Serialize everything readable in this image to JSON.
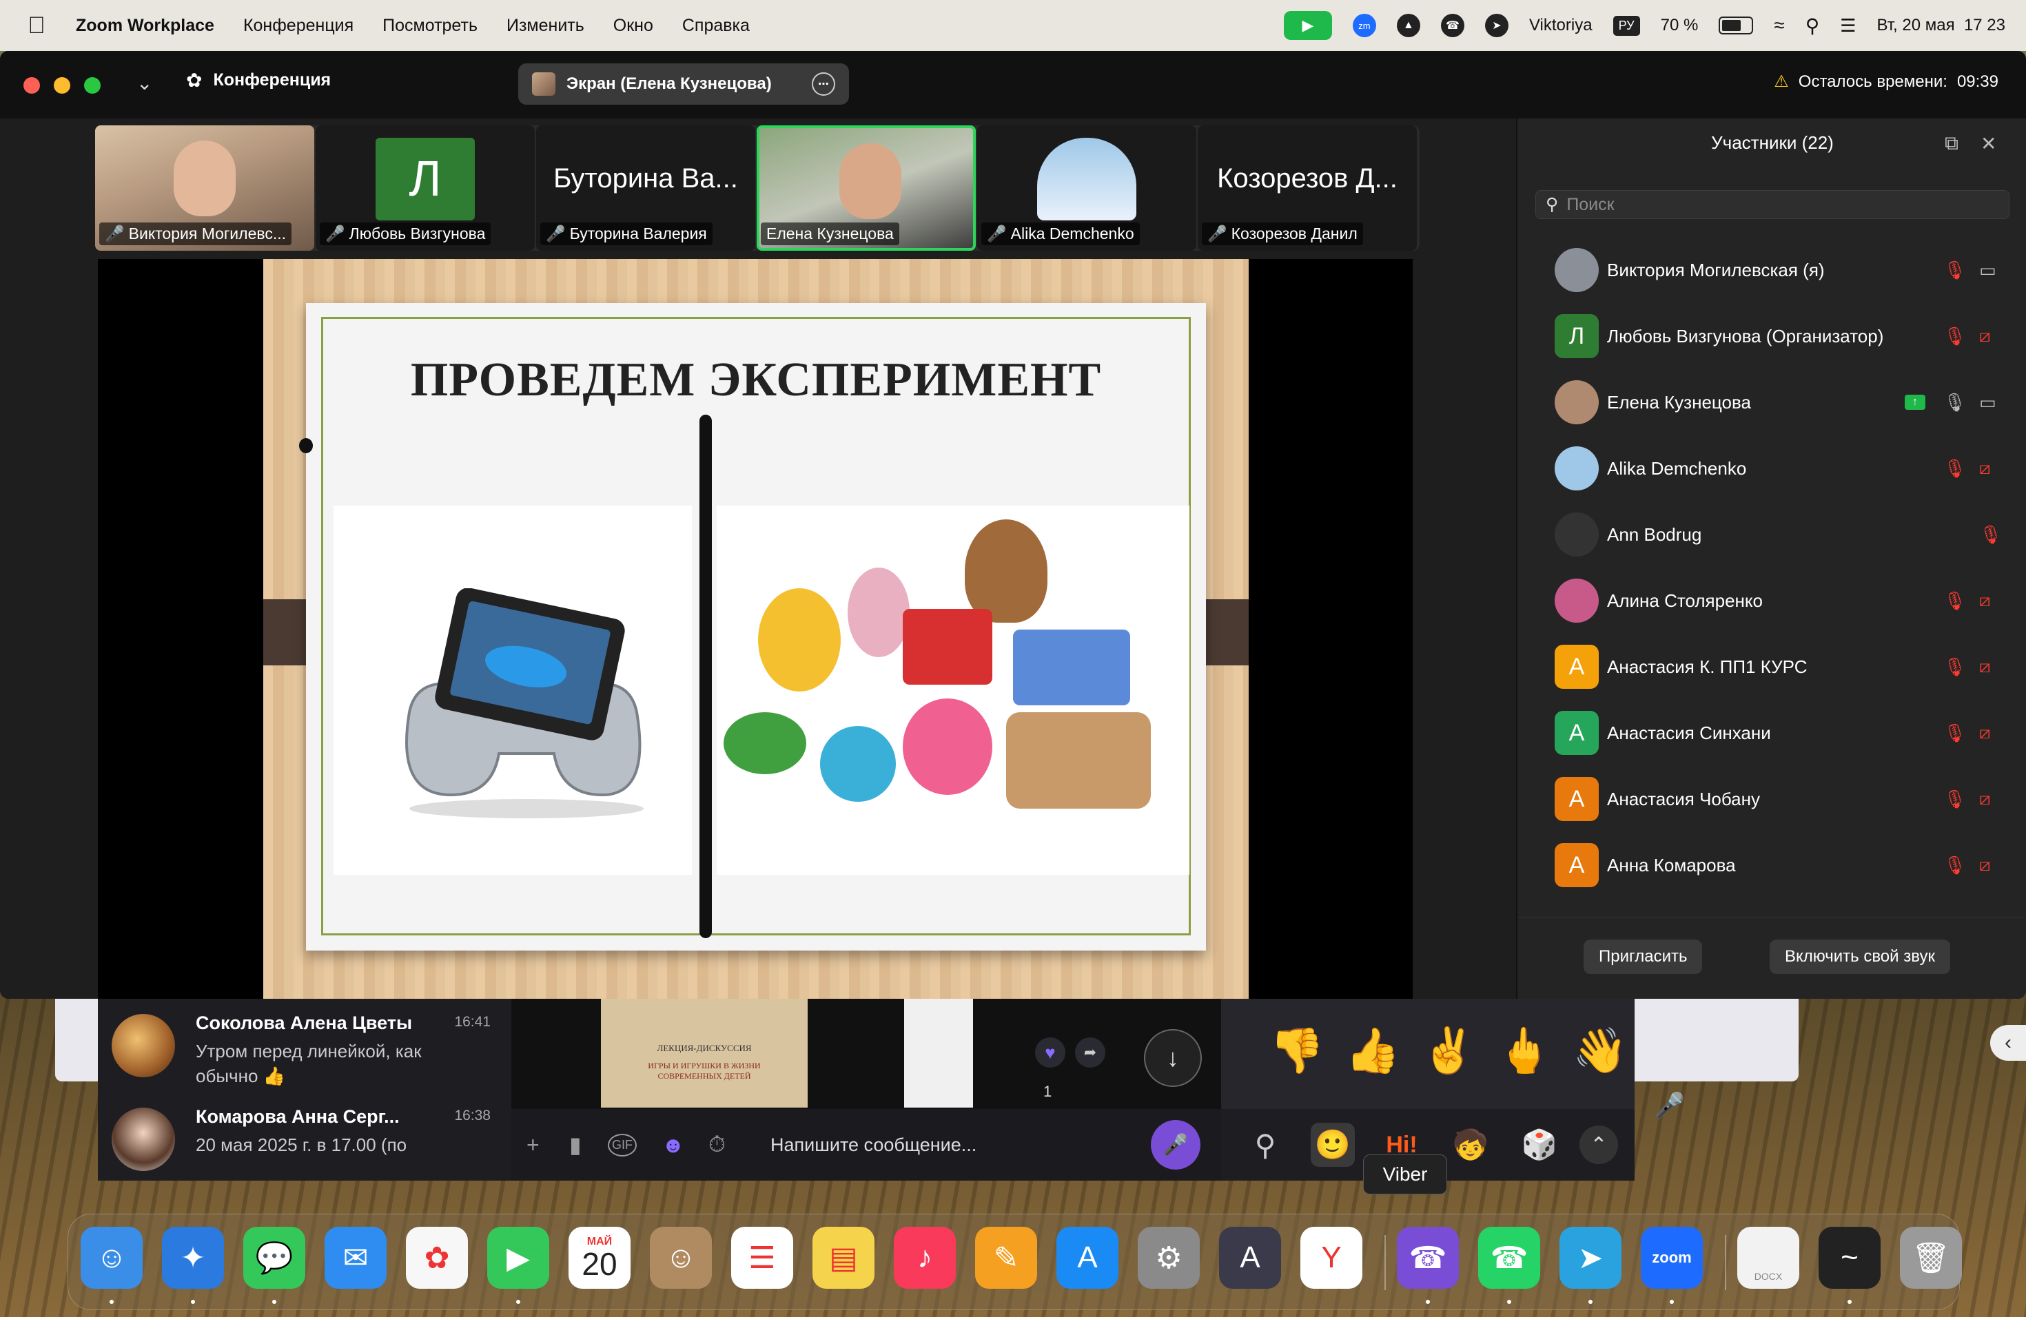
{
  "menubar": {
    "app_name": "Zoom Workplace",
    "menus": [
      "Конференция",
      "Посмотреть",
      "Изменить",
      "Окно",
      "Справка"
    ],
    "user": "Viktoriya",
    "input_source": "РУ",
    "battery": "70 %",
    "battery_level": 0.7,
    "datetime": "Вт, 20 мая  17 23"
  },
  "zoom": {
    "title": "Конференция",
    "screen_share_label": "Экран (Елена Кузнецова)",
    "time_left_label": "Осталось времени:",
    "time_left_value": "09:39",
    "tiles": [
      {
        "name": "Виктория Могилевс...",
        "muted": true
      },
      {
        "name": "Любовь Визгунова",
        "muted": true,
        "letter": "Л"
      },
      {
        "name": "Буторина Валерия",
        "muted": true,
        "big": "Буторина Ва..."
      },
      {
        "name": "Елена Кузнецова",
        "muted": false
      },
      {
        "name": "Alika Demchenko",
        "muted": true
      },
      {
        "name": "Козорезов Данил",
        "muted": true,
        "big": "Козорезов Д..."
      }
    ],
    "slide_title": "ПРОВЕДЕМ ЭКСПЕРИМЕНТ"
  },
  "participants": {
    "header": "Участники (22)",
    "search_placeholder": "Поиск",
    "items": [
      {
        "name": "Виктория Могилевская (я)",
        "avatar": "photo",
        "color": "#8a8f98",
        "mic": "off",
        "cam": "on"
      },
      {
        "name": "Любовь Визгунова (Организатор)",
        "avatar": "Л",
        "color": "#2e7d32",
        "mic": "off",
        "cam": "off"
      },
      {
        "name": "Елена Кузнецова",
        "avatar": "photo",
        "color": "#b08a70",
        "mic": "on",
        "cam": "on",
        "sharing": true
      },
      {
        "name": "Alika Demchenko",
        "avatar": "photo",
        "color": "#9fc8e8",
        "mic": "off",
        "cam": "off"
      },
      {
        "name": "Ann Bodrug",
        "avatar": "photo",
        "color": "#333333",
        "mic": "off",
        "cam": "none"
      },
      {
        "name": "Алина Столяренко",
        "avatar": "photo",
        "color": "#c85a8a",
        "mic": "off",
        "cam": "off"
      },
      {
        "name": "Анастасия К. ПП1 КУРС",
        "avatar": "А",
        "color": "#f5a10a",
        "mic": "off",
        "cam": "off"
      },
      {
        "name": "Анастасия Синхани",
        "avatar": "А",
        "color": "#26a65b",
        "mic": "off",
        "cam": "off"
      },
      {
        "name": "Анастасия Чобану",
        "avatar": "А",
        "color": "#e8790c",
        "mic": "off",
        "cam": "off"
      },
      {
        "name": "Анна Комарова",
        "avatar": "А",
        "color": "#e8790c",
        "mic": "off",
        "cam": "off"
      }
    ],
    "invite_label": "Пригласить",
    "unmute_label": "Включить свой звук"
  },
  "viber": {
    "chats": [
      {
        "name": "Соколова Алена Цветы",
        "time": "16:41",
        "message": "Утром перед линейкой, как обычно 👍"
      },
      {
        "name": "Комарова Анна Серг...",
        "time": "16:38",
        "message": "20 мая 2025 г. в 17.00 (по"
      }
    ],
    "composer_placeholder": "Напишите сообщение...",
    "reaction_count": "1",
    "tooltip": "Viber",
    "thumb_title": "ЛЕКЦИЯ-ДИСКУССИЯ",
    "thumb_sub": "ИГРЫ И ИГРУШКИ В ЖИЗНИ СОВРЕМЕННЫХ ДЕТЕЙ"
  },
  "dock": {
    "calendar_month": "МАЙ",
    "calendar_day": "20",
    "zoom_label": "zoom",
    "docx_label": "DOCX",
    "apps": [
      "Finder",
      "Safari",
      "Messages",
      "Mail",
      "Photos",
      "FaceTime",
      "Calendar",
      "Contacts",
      "Reminders",
      "Notes",
      "Music",
      "Pages",
      "App Store",
      "System Settings",
      "Instruments",
      "Yandex",
      "Viber",
      "WhatsApp",
      "Telegram",
      "Zoom",
      "Document",
      "Activity Monitor",
      "Trash"
    ]
  }
}
